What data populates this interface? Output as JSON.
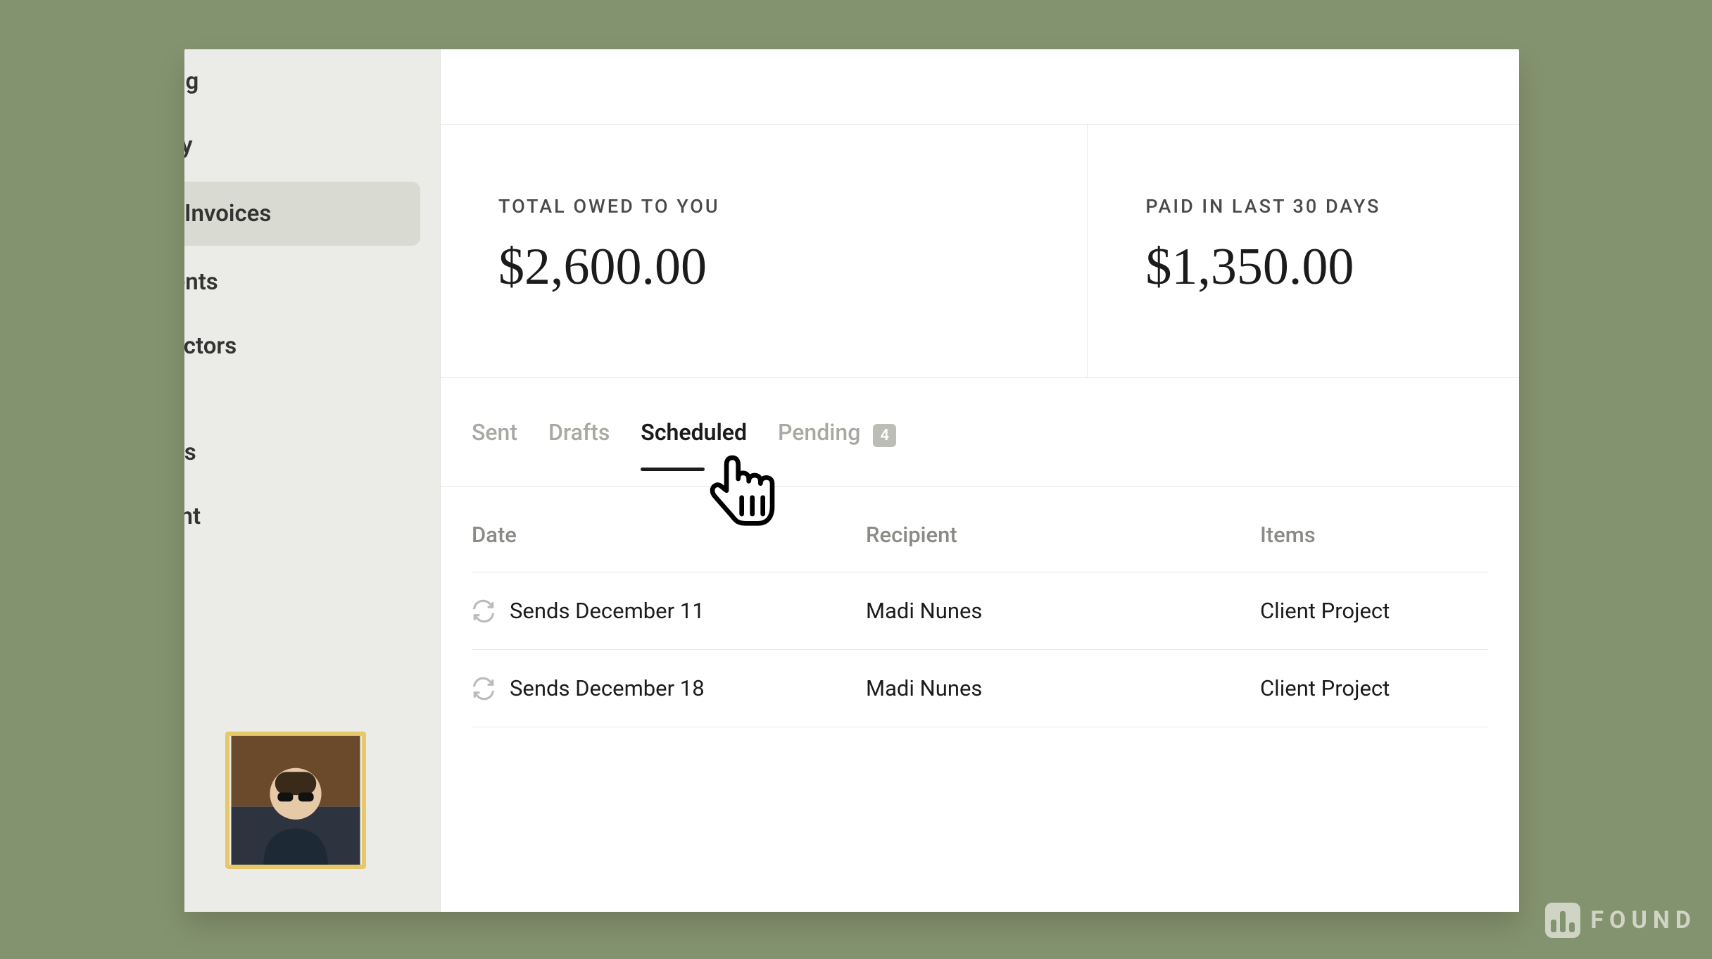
{
  "sidebar": {
    "items": [
      {
        "label": "Banking"
      },
      {
        "label": "Activity"
      },
      {
        "label": "Invoices"
      },
      {
        "label": "Payments"
      },
      {
        "label": "Contractors"
      },
      {
        "label": "Reports"
      },
      {
        "label": "Account"
      }
    ],
    "activeIndex": 2
  },
  "stats": {
    "owed_label": "TOTAL OWED TO YOU",
    "owed_value": "$2,600.00",
    "paid_label": "PAID IN LAST 30 DAYS",
    "paid_value": "$1,350.00"
  },
  "tabs": {
    "sent": "Sent",
    "drafts": "Drafts",
    "scheduled": "Scheduled",
    "pending": "Pending",
    "pending_count": "4",
    "active": "scheduled"
  },
  "columns": {
    "date": "Date",
    "recipient": "Recipient",
    "items": "Items"
  },
  "rows": [
    {
      "date": "Sends December 11",
      "recipient": "Madi Nunes",
      "items": "Client Project"
    },
    {
      "date": "Sends December 18",
      "recipient": "Madi Nunes",
      "items": "Client Project"
    }
  ],
  "brand": "FOUND"
}
